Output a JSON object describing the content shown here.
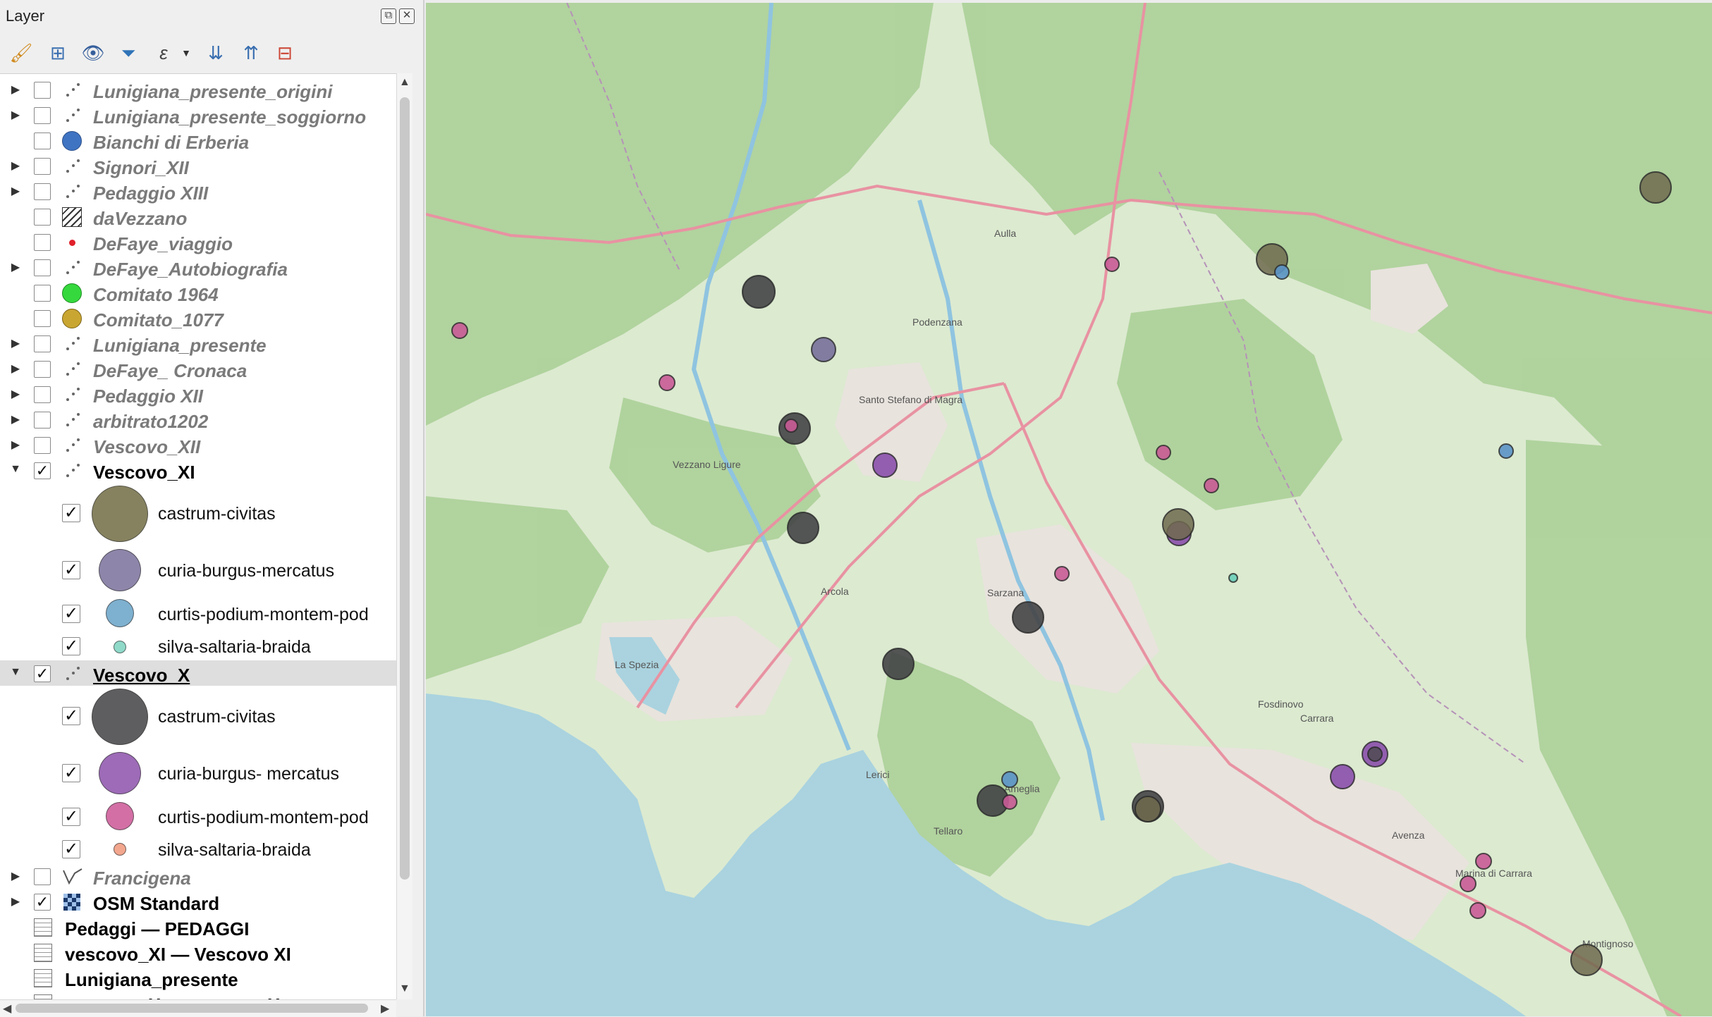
{
  "panel": {
    "title": "Layer",
    "controls": {
      "float_icon": "float-icon",
      "close_icon": "close-icon"
    },
    "toolbar": [
      "paint-style-icon",
      "add-group-icon",
      "eye-icon",
      "filter-icon",
      "expression-icon",
      "expand-all-icon",
      "collapse-all-icon",
      "remove-layer-icon"
    ]
  },
  "layers": [
    {
      "name": "Lunigiana_presente_origini",
      "expander": true,
      "checked": false,
      "icon": "point-layer-icon"
    },
    {
      "name": "Lunigiana_presente_soggiorno",
      "expander": true,
      "checked": false,
      "icon": "point-layer-icon"
    },
    {
      "name": "Bianchi di Erberia",
      "expander": false,
      "checked": false,
      "icon": "blue-circle-icon",
      "color": "#3f74c2"
    },
    {
      "name": "Signori_XII",
      "expander": true,
      "checked": false,
      "icon": "point-layer-icon"
    },
    {
      "name": "Pedaggio XIII",
      "expander": true,
      "checked": false,
      "icon": "point-layer-icon"
    },
    {
      "name": "daVezzano",
      "expander": false,
      "checked": false,
      "icon": "hatched-polygon-icon"
    },
    {
      "name": "DeFaye_viaggio",
      "expander": false,
      "checked": false,
      "icon": "red-dot-icon",
      "color": "#e0202a"
    },
    {
      "name": "DeFaye_Autobiografia",
      "expander": true,
      "checked": false,
      "icon": "point-layer-icon"
    },
    {
      "name": "Comitato 1964",
      "expander": false,
      "checked": false,
      "icon": "green-circle-icon",
      "color": "#35d83d"
    },
    {
      "name": "Comitato_1077",
      "expander": false,
      "checked": false,
      "icon": "gold-circle-icon",
      "color": "#c9a632"
    },
    {
      "name": "Lunigiana_presente",
      "expander": true,
      "checked": false,
      "icon": "point-layer-icon"
    },
    {
      "name": "DeFaye_ Cronaca",
      "expander": true,
      "checked": false,
      "icon": "point-layer-icon"
    },
    {
      "name": "Pedaggio XII",
      "expander": true,
      "checked": false,
      "icon": "point-layer-icon"
    },
    {
      "name": "arbitrato1202",
      "expander": true,
      "checked": false,
      "icon": "point-layer-icon"
    },
    {
      "name": "Vescovo_XII",
      "expander": true,
      "checked": false,
      "icon": "point-layer-icon"
    }
  ],
  "vescovo_xi": {
    "name": "Vescovo_XI",
    "checked": true,
    "expanded": true,
    "classes": [
      {
        "label": "castrum-civitas",
        "color": "#86825f"
      },
      {
        "label": "curia-burgus-mercatus",
        "color": "#8e85aa"
      },
      {
        "label": "curtis-podium-montem-pod",
        "color": "#7eb0cf"
      },
      {
        "label": "silva-saltaria-braida",
        "color": "#8fd9c9"
      }
    ]
  },
  "vescovo_x": {
    "name": "Vescovo_X",
    "checked": true,
    "expanded": true,
    "selected": true,
    "classes": [
      {
        "label": "castrum-civitas",
        "color": "#5e5e60"
      },
      {
        "label": "curia-burgus- mercatus",
        "color": "#9d6bb7"
      },
      {
        "label": "curtis-podium-montem-pod",
        "color": "#d36fa5"
      },
      {
        "label": "silva-saltaria-braida",
        "color": "#f2a68d"
      }
    ]
  },
  "bottom_layers": [
    {
      "name": "Francigena",
      "expander": true,
      "checked": false,
      "icon": "line-layer-icon",
      "active": false
    },
    {
      "name": "OSM Standard",
      "expander": true,
      "checked": true,
      "icon": "raster-tile-icon",
      "active": true
    }
  ],
  "tables": [
    "Pedaggi — PEDAGGI",
    "vescovo_XI — Vescovo XI",
    "Lunigiana_presente",
    "vescovo_X — vescovo X"
  ],
  "map": {
    "basemap": "OSM Standard",
    "colors": {
      "land": "#dcead0",
      "forest": "#a9cf95",
      "sea": "#aad3df",
      "urban": "#e8e3dd",
      "road": "#e892a2",
      "border": "#b592b8"
    },
    "place_labels": [
      "La Spezia",
      "Aulla",
      "Sarzana",
      "Lerici",
      "Carrara",
      "Avenza",
      "Marina di Carrara",
      "Santo Stefano di Magra",
      "Podenzana",
      "Fosdinovo",
      "Vezzano Ligure",
      "Arcola",
      "Ameglia",
      "Tellaro",
      "Montignoso"
    ]
  }
}
